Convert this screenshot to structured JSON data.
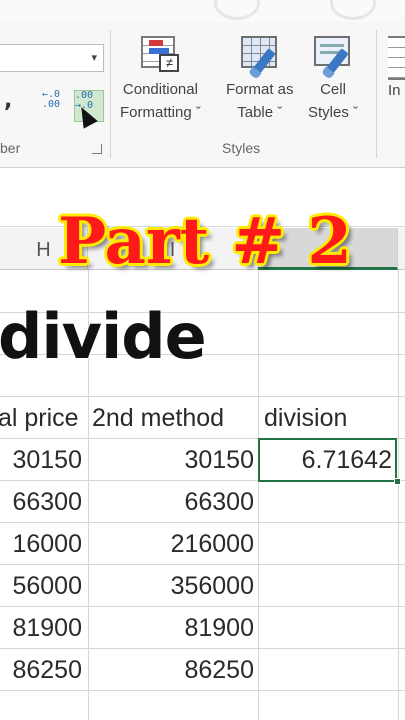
{
  "ribbon": {
    "number_format_value": "",
    "comma_symbol": ",",
    "decrease_decimal": "←.0 .00",
    "increase_decimal": ".00 →.0",
    "number_group_label": "ber",
    "styles_group_label": "Styles",
    "conditional_formatting": {
      "line1": "Conditional",
      "line2": "Formatting ˇ"
    },
    "format_as_table": {
      "line1": "Format as",
      "line2": "Table ˇ"
    },
    "cell_styles": {
      "line1": "Cell",
      "line2": "Styles ˇ"
    },
    "insert_label": "In"
  },
  "columns": [
    {
      "label": "H",
      "selected": false
    },
    {
      "label": "I",
      "selected": false
    },
    {
      "label": "",
      "selected": true
    },
    {
      "label": "",
      "selected": false
    }
  ],
  "sheet": {
    "title": "divide",
    "headers": [
      "al price",
      "2nd method",
      "division"
    ],
    "rows": [
      [
        "30150",
        "30150",
        "6.71642"
      ],
      [
        "66300",
        "66300",
        ""
      ],
      [
        "16000",
        "216000",
        ""
      ],
      [
        "56000",
        "356000",
        ""
      ],
      [
        "81900",
        "81900",
        ""
      ],
      [
        "86250",
        "86250",
        ""
      ]
    ]
  },
  "overlay": {
    "text": "Part # 2"
  },
  "colors": {
    "selection_green": "#217346",
    "banner_red": "#ff1a1a",
    "banner_yellow": "#ffeb00"
  }
}
